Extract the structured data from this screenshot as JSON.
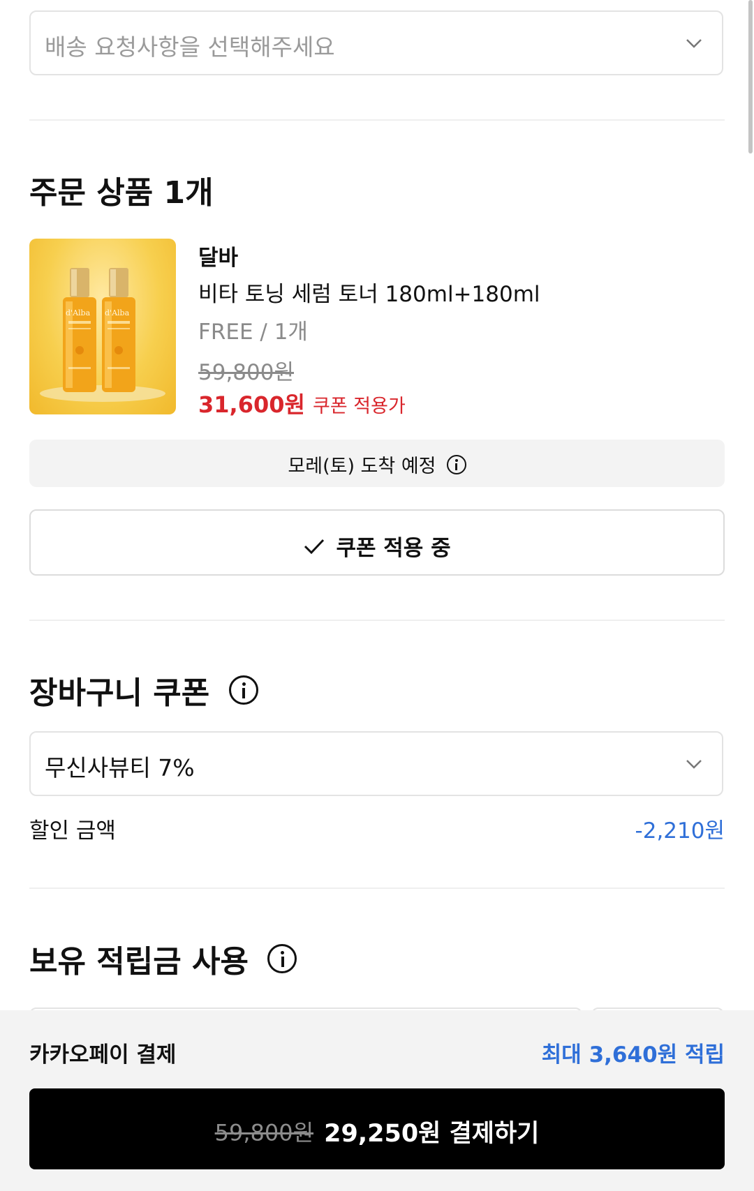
{
  "delivery": {
    "placeholder": "배송 요청사항을 선택해주세요"
  },
  "order": {
    "title": "주문 상품 1개",
    "product": {
      "brand": "달바",
      "name": "비타 토닝 세럼 토너 180ml+180ml",
      "option": "FREE / 1개",
      "original_price": "59,800원",
      "sale_price": "31,600원",
      "coupon_note": "쿠폰 적용가",
      "image_label": "d'Alba"
    },
    "arrival": "모레(토) 도착 예정",
    "coupon_button": "쿠폰 적용 중"
  },
  "cart_coupon": {
    "title": "장바구니 쿠폰",
    "selected": "무신사뷰티 7%",
    "discount_label": "할인 금액",
    "discount_value": "-2,210원"
  },
  "points": {
    "title": "보유 적립금 사용"
  },
  "footer": {
    "payment_method": "카카오페이 결제",
    "reward": "최대 3,640원 적립",
    "original_total": "59,800원",
    "pay_label": "29,250원 결제하기"
  },
  "colors": {
    "accent_blue": "#2f6fd8",
    "sale_red": "#d9262c",
    "pay_button": "#000000",
    "product_bg": "#f7cf4e"
  },
  "icons": [
    "chevron-down-icon",
    "info-icon",
    "check-icon"
  ]
}
